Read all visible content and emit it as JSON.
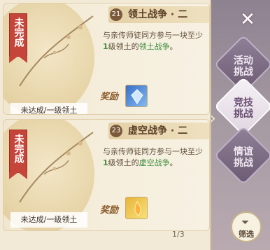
{
  "cards": [
    {
      "status_ribbon": "未完成",
      "number": "21",
      "title": "领土战争 · 二",
      "desc_parts": [
        "与亲传师徒同方参与一块至少",
        "1",
        "级领土的",
        "领土战争",
        "。"
      ],
      "status_strip": "未达成/一级领土",
      "reward_label": "奖励"
    },
    {
      "status_ribbon": "未完成",
      "number": "23",
      "title": "虚空战争 · 二",
      "desc_parts": [
        "与亲传师徒同方参与一块至少",
        "1",
        "级领土的",
        "虚空战争",
        "。"
      ],
      "status_strip": "未达成/一级领土",
      "reward_label": "奖励"
    }
  ],
  "pagination": "1/3",
  "side_tabs": [
    "活动挑战",
    "竞技挑战",
    "情谊挑战"
  ],
  "close_icon": "close-icon",
  "filter_label": "筛选",
  "colors": {
    "ribbon": "#c6453a",
    "highlight": "#3d8f3d"
  }
}
